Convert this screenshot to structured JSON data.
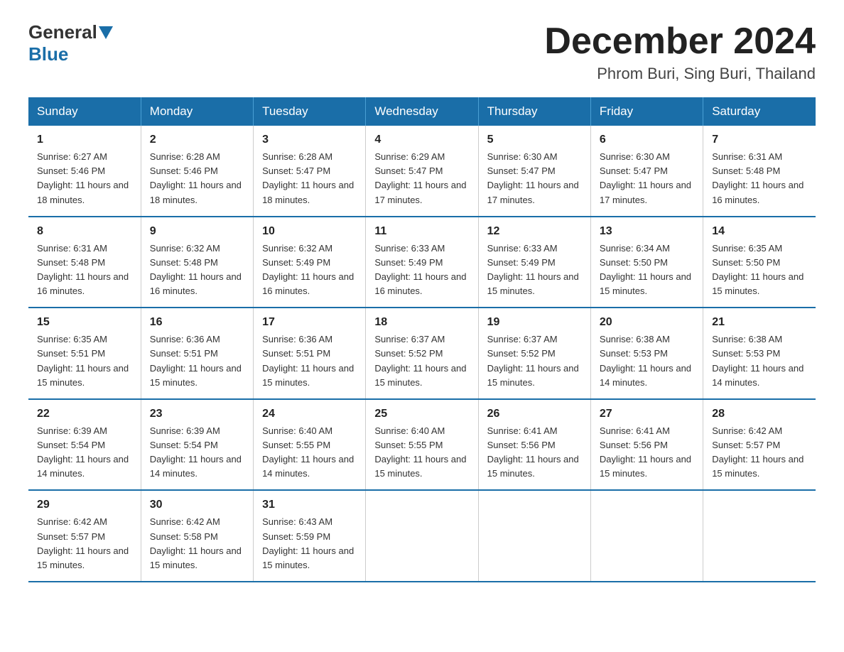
{
  "header": {
    "logo_general": "General",
    "logo_blue": "Blue",
    "month_year": "December 2024",
    "location": "Phrom Buri, Sing Buri, Thailand"
  },
  "weekdays": [
    "Sunday",
    "Monday",
    "Tuesday",
    "Wednesday",
    "Thursday",
    "Friday",
    "Saturday"
  ],
  "weeks": [
    [
      {
        "day": "1",
        "sunrise": "6:27 AM",
        "sunset": "5:46 PM",
        "daylight": "11 hours and 18 minutes."
      },
      {
        "day": "2",
        "sunrise": "6:28 AM",
        "sunset": "5:46 PM",
        "daylight": "11 hours and 18 minutes."
      },
      {
        "day": "3",
        "sunrise": "6:28 AM",
        "sunset": "5:47 PM",
        "daylight": "11 hours and 18 minutes."
      },
      {
        "day": "4",
        "sunrise": "6:29 AM",
        "sunset": "5:47 PM",
        "daylight": "11 hours and 17 minutes."
      },
      {
        "day": "5",
        "sunrise": "6:30 AM",
        "sunset": "5:47 PM",
        "daylight": "11 hours and 17 minutes."
      },
      {
        "day": "6",
        "sunrise": "6:30 AM",
        "sunset": "5:47 PM",
        "daylight": "11 hours and 17 minutes."
      },
      {
        "day": "7",
        "sunrise": "6:31 AM",
        "sunset": "5:48 PM",
        "daylight": "11 hours and 16 minutes."
      }
    ],
    [
      {
        "day": "8",
        "sunrise": "6:31 AM",
        "sunset": "5:48 PM",
        "daylight": "11 hours and 16 minutes."
      },
      {
        "day": "9",
        "sunrise": "6:32 AM",
        "sunset": "5:48 PM",
        "daylight": "11 hours and 16 minutes."
      },
      {
        "day": "10",
        "sunrise": "6:32 AM",
        "sunset": "5:49 PM",
        "daylight": "11 hours and 16 minutes."
      },
      {
        "day": "11",
        "sunrise": "6:33 AM",
        "sunset": "5:49 PM",
        "daylight": "11 hours and 16 minutes."
      },
      {
        "day": "12",
        "sunrise": "6:33 AM",
        "sunset": "5:49 PM",
        "daylight": "11 hours and 15 minutes."
      },
      {
        "day": "13",
        "sunrise": "6:34 AM",
        "sunset": "5:50 PM",
        "daylight": "11 hours and 15 minutes."
      },
      {
        "day": "14",
        "sunrise": "6:35 AM",
        "sunset": "5:50 PM",
        "daylight": "11 hours and 15 minutes."
      }
    ],
    [
      {
        "day": "15",
        "sunrise": "6:35 AM",
        "sunset": "5:51 PM",
        "daylight": "11 hours and 15 minutes."
      },
      {
        "day": "16",
        "sunrise": "6:36 AM",
        "sunset": "5:51 PM",
        "daylight": "11 hours and 15 minutes."
      },
      {
        "day": "17",
        "sunrise": "6:36 AM",
        "sunset": "5:51 PM",
        "daylight": "11 hours and 15 minutes."
      },
      {
        "day": "18",
        "sunrise": "6:37 AM",
        "sunset": "5:52 PM",
        "daylight": "11 hours and 15 minutes."
      },
      {
        "day": "19",
        "sunrise": "6:37 AM",
        "sunset": "5:52 PM",
        "daylight": "11 hours and 15 minutes."
      },
      {
        "day": "20",
        "sunrise": "6:38 AM",
        "sunset": "5:53 PM",
        "daylight": "11 hours and 14 minutes."
      },
      {
        "day": "21",
        "sunrise": "6:38 AM",
        "sunset": "5:53 PM",
        "daylight": "11 hours and 14 minutes."
      }
    ],
    [
      {
        "day": "22",
        "sunrise": "6:39 AM",
        "sunset": "5:54 PM",
        "daylight": "11 hours and 14 minutes."
      },
      {
        "day": "23",
        "sunrise": "6:39 AM",
        "sunset": "5:54 PM",
        "daylight": "11 hours and 14 minutes."
      },
      {
        "day": "24",
        "sunrise": "6:40 AM",
        "sunset": "5:55 PM",
        "daylight": "11 hours and 14 minutes."
      },
      {
        "day": "25",
        "sunrise": "6:40 AM",
        "sunset": "5:55 PM",
        "daylight": "11 hours and 15 minutes."
      },
      {
        "day": "26",
        "sunrise": "6:41 AM",
        "sunset": "5:56 PM",
        "daylight": "11 hours and 15 minutes."
      },
      {
        "day": "27",
        "sunrise": "6:41 AM",
        "sunset": "5:56 PM",
        "daylight": "11 hours and 15 minutes."
      },
      {
        "day": "28",
        "sunrise": "6:42 AM",
        "sunset": "5:57 PM",
        "daylight": "11 hours and 15 minutes."
      }
    ],
    [
      {
        "day": "29",
        "sunrise": "6:42 AM",
        "sunset": "5:57 PM",
        "daylight": "11 hours and 15 minutes."
      },
      {
        "day": "30",
        "sunrise": "6:42 AM",
        "sunset": "5:58 PM",
        "daylight": "11 hours and 15 minutes."
      },
      {
        "day": "31",
        "sunrise": "6:43 AM",
        "sunset": "5:59 PM",
        "daylight": "11 hours and 15 minutes."
      },
      null,
      null,
      null,
      null
    ]
  ]
}
